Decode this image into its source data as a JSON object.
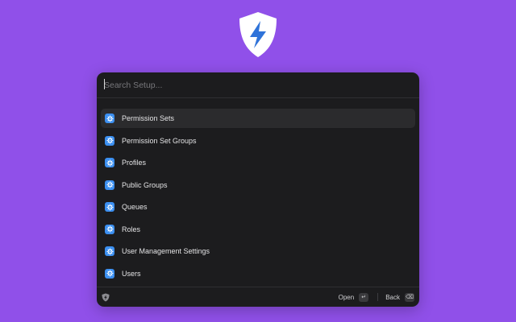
{
  "app": {
    "logo_icon": "shield-bolt-icon",
    "colors": {
      "background": "#9050e9",
      "panel": "#1c1c1e",
      "accent": "#3b8ff0",
      "bolt": "#2f73d9"
    }
  },
  "search": {
    "placeholder": "Search Setup...",
    "value": ""
  },
  "results": [
    {
      "label": "Permission Sets",
      "icon": "gear-icon",
      "selected": true
    },
    {
      "label": "Permission Set Groups",
      "icon": "gear-icon",
      "selected": false
    },
    {
      "label": "Profiles",
      "icon": "gear-icon",
      "selected": false
    },
    {
      "label": "Public Groups",
      "icon": "gear-icon",
      "selected": false
    },
    {
      "label": "Queues",
      "icon": "gear-icon",
      "selected": false
    },
    {
      "label": "Roles",
      "icon": "gear-icon",
      "selected": false
    },
    {
      "label": "User Management Settings",
      "icon": "gear-icon",
      "selected": false
    },
    {
      "label": "Users",
      "icon": "gear-icon",
      "selected": false
    }
  ],
  "footer": {
    "open_label": "Open",
    "open_key": "↵",
    "back_label": "Back",
    "back_key": "⌫"
  }
}
